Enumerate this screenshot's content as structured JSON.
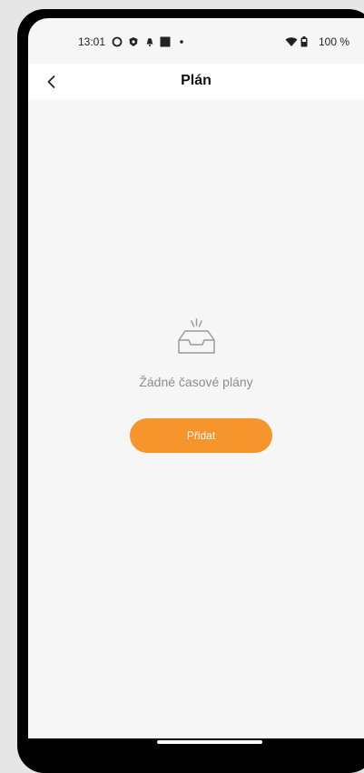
{
  "status_bar": {
    "time": "13:01",
    "battery": "100 %",
    "icons": [
      "circle-icon",
      "shield-icon",
      "notification-icon",
      "square-icon",
      "dot-icon",
      "wifi-icon",
      "battery-icon"
    ]
  },
  "header": {
    "title": "Plán",
    "back_icon": "chevron-left-icon"
  },
  "empty_state": {
    "icon": "empty-inbox-icon",
    "message": "Žádné časové plány"
  },
  "actions": {
    "add_label": "Přidat"
  },
  "colors": {
    "accent": "#f7952d",
    "background": "#f6f6f6",
    "header_bg": "#ffffff",
    "muted_text": "#8c8c8c"
  }
}
